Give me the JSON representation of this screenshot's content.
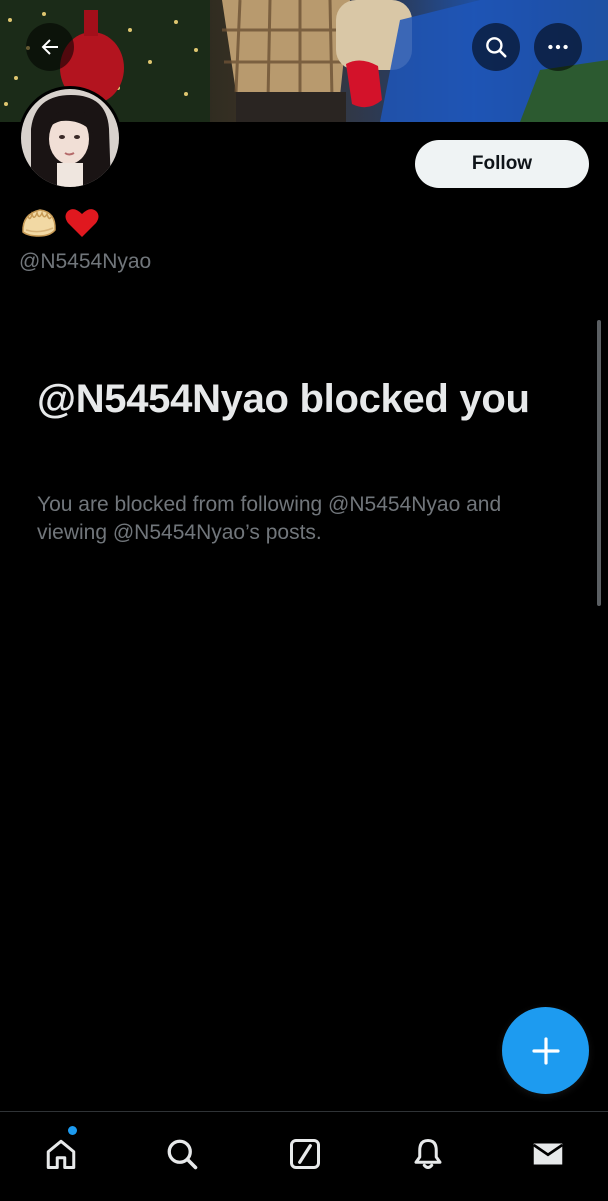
{
  "profile": {
    "handle": "@N5454Nyao",
    "display_name_emoji": [
      "dumpling-emoji",
      "red-heart-emoji"
    ],
    "follow_label": "Follow"
  },
  "blocked": {
    "title": "@N5454Nyao blocked you",
    "description": "You are blocked from following @N5454Nyao and viewing @N5454Nyao’s posts."
  },
  "header_icons": {
    "back": "back-arrow-icon",
    "search": "search-icon",
    "more": "more-options-icon"
  },
  "bottom_nav": {
    "items": [
      "home-icon",
      "search-icon",
      "grok-icon",
      "notifications-icon",
      "messages-icon"
    ],
    "home_has_notification_dot": true
  },
  "fab": {
    "icon": "plus-icon"
  },
  "colors": {
    "background": "#000000",
    "primary_text": "#e7e9ea",
    "secondary_text": "#71767b",
    "accent": "#1d9bf0",
    "follow_button_bg": "#eff3f4"
  }
}
